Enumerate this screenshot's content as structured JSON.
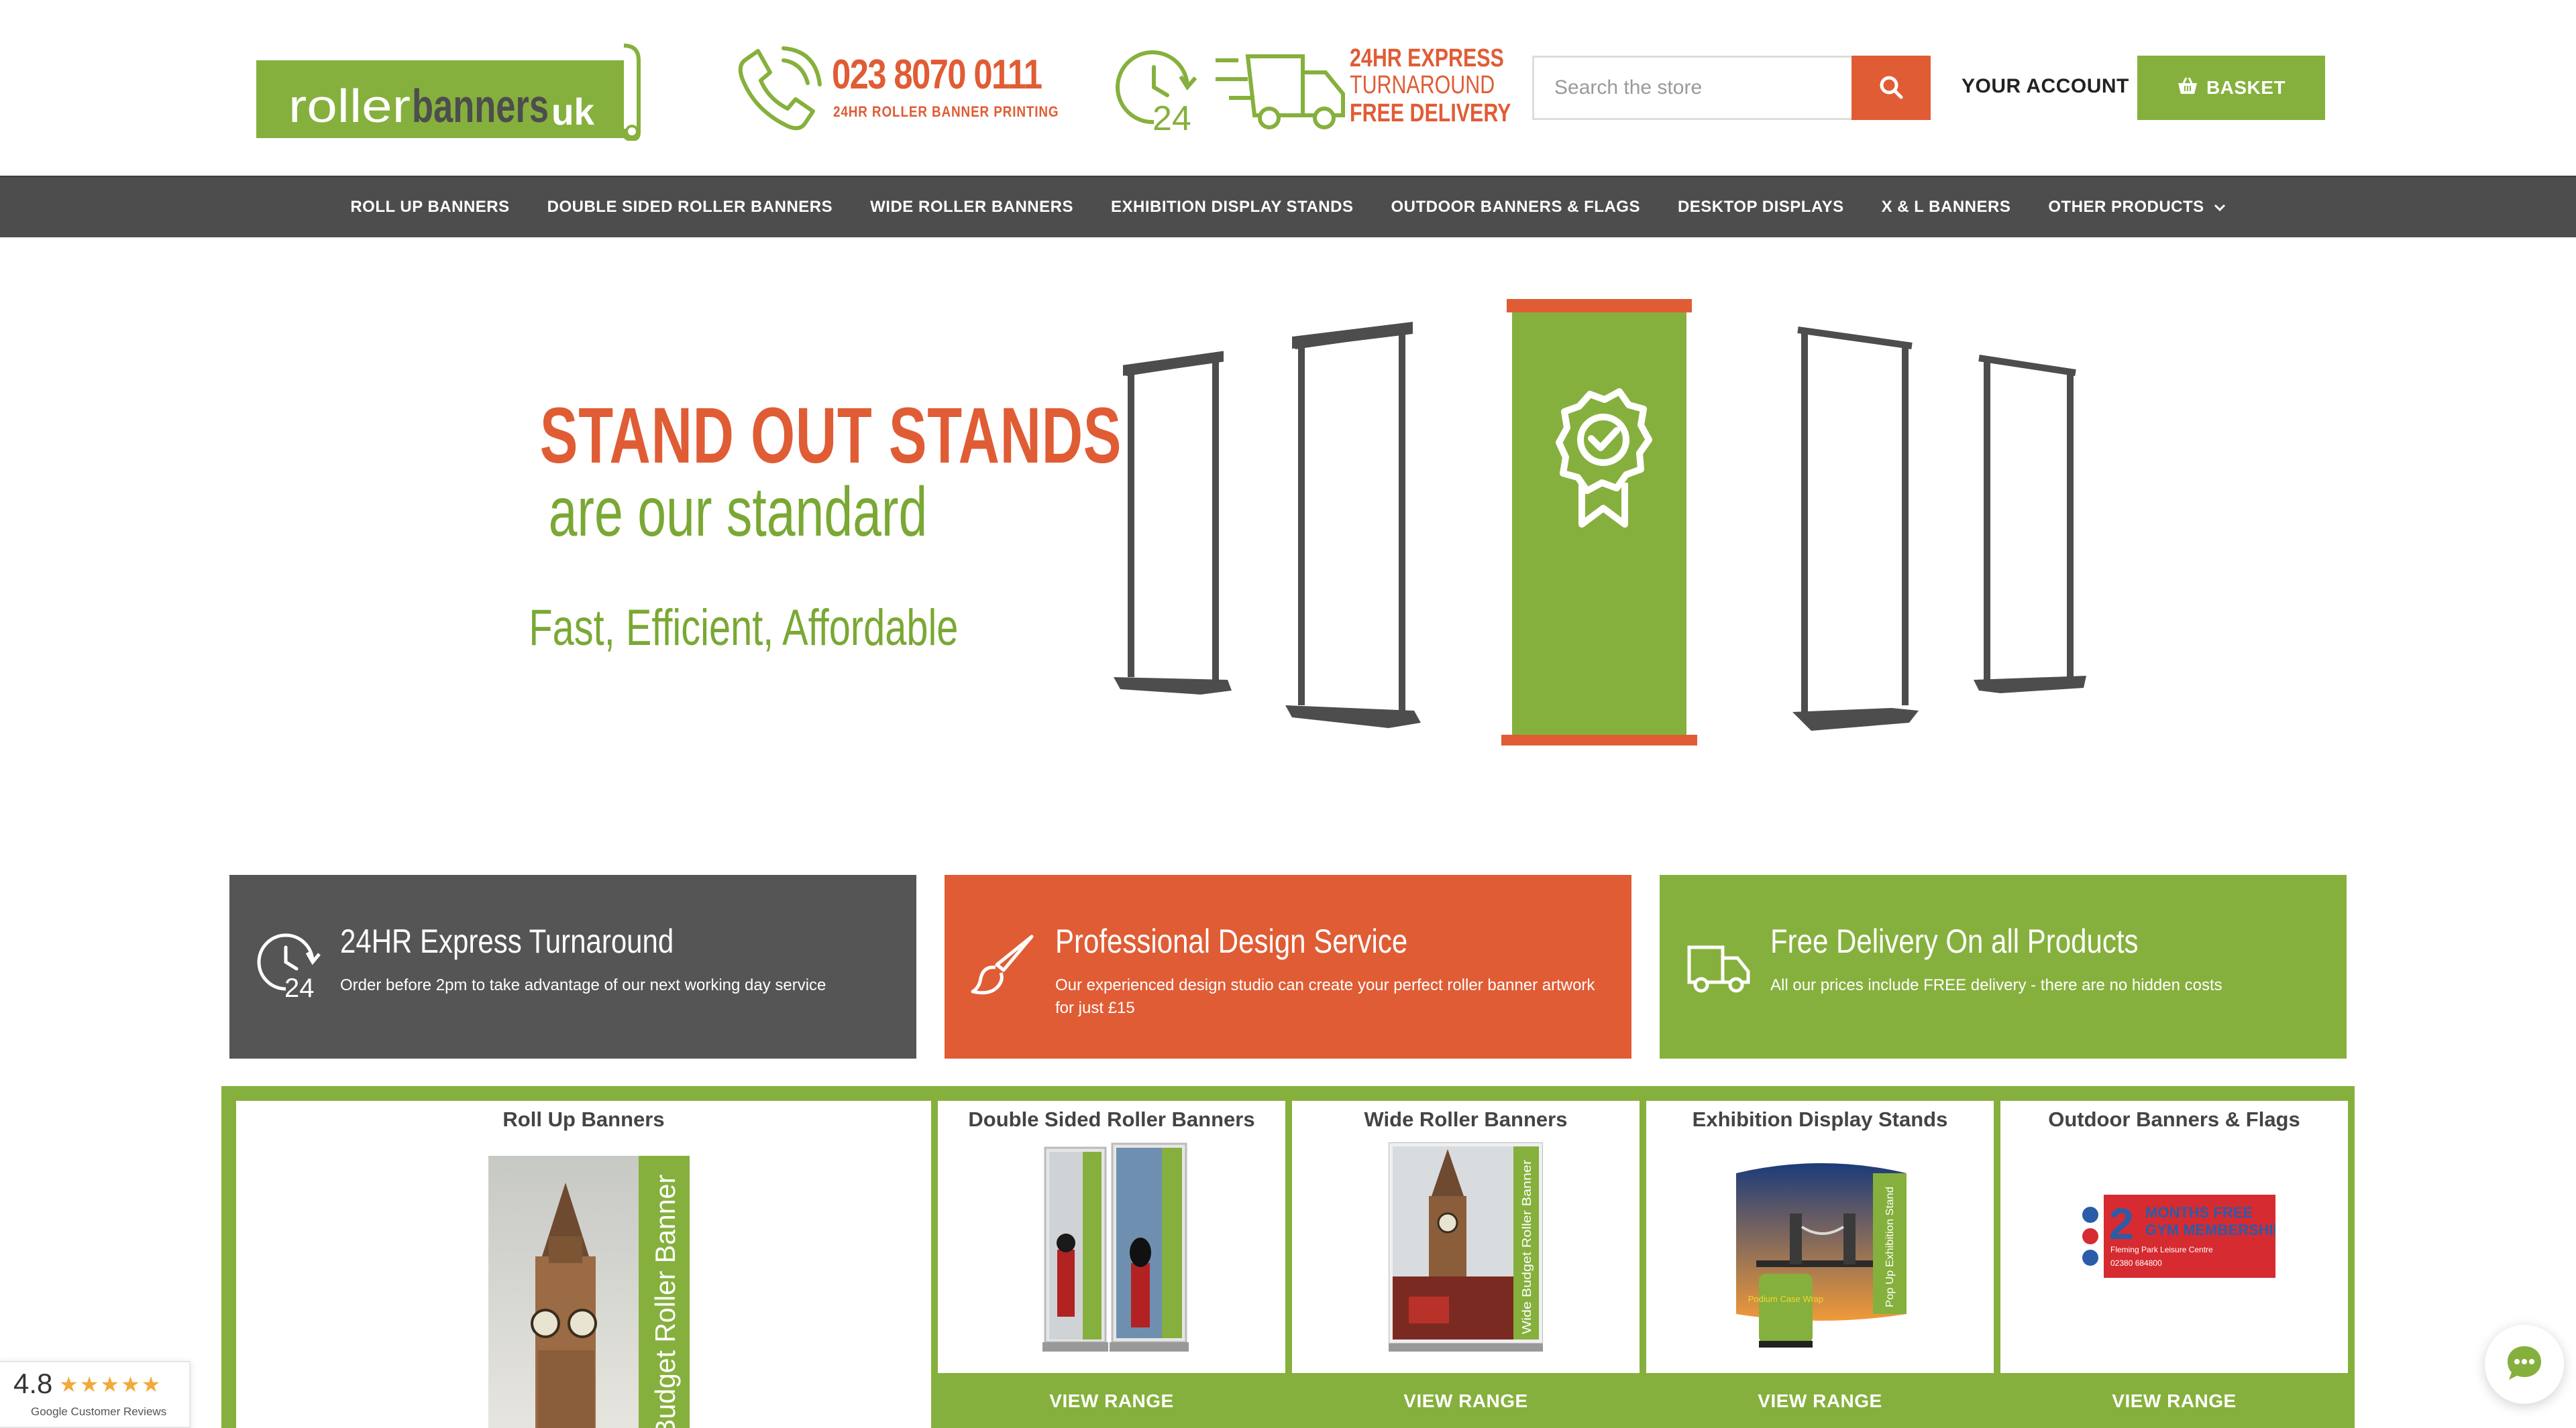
{
  "header": {
    "logo": {
      "word1": "roller",
      "word2": "banners",
      "word3": "uk"
    },
    "phone": {
      "number": "023 8070 0111",
      "sub": "24HR ROLLER BANNER PRINTING"
    },
    "delivery": {
      "line1": "24HR EXPRESS",
      "line2": "TURNAROUND",
      "line3": "FREE DELIVERY",
      "clock_number": "24"
    },
    "search": {
      "placeholder": "Search the store",
      "value": ""
    },
    "account_label": "YOUR ACCOUNT",
    "basket_label": "BASKET"
  },
  "nav": {
    "items": [
      {
        "label": "ROLL UP BANNERS"
      },
      {
        "label": "DOUBLE SIDED ROLLER BANNERS"
      },
      {
        "label": "WIDE ROLLER BANNERS"
      },
      {
        "label": "EXHIBITION DISPLAY STANDS"
      },
      {
        "label": "OUTDOOR BANNERS & FLAGS"
      },
      {
        "label": "DESKTOP DISPLAYS"
      },
      {
        "label": "X & L BANNERS"
      },
      {
        "label": "OTHER PRODUCTS"
      }
    ]
  },
  "hero": {
    "title": "STAND OUT STANDS",
    "subtitle": "are our standard",
    "tagline": "Fast, Efficient, Affordable"
  },
  "features": [
    {
      "title": "24HR Express Turnaround",
      "description": "Order before 2pm to take advantage of our next working day service",
      "icon_number": "24"
    },
    {
      "title": "Professional Design Service",
      "description": "Our experienced design studio can create your perfect roller banner artwork for just £15"
    },
    {
      "title": "Free Delivery On all Products",
      "description": "All our prices include FREE delivery - there are no hidden costs"
    }
  ],
  "categories": [
    {
      "title": "Roll Up Banners",
      "image_text": "Budget Roller Banner"
    },
    {
      "title": "Double Sided Roller Banners",
      "button": "VIEW RANGE"
    },
    {
      "title": "Wide Roller Banners",
      "button": "VIEW RANGE",
      "image_text": "Wide Budget Roller Banner"
    },
    {
      "title": "Exhibition Display Stands",
      "button": "VIEW RANGE",
      "image_text": "Pop Up Exhibition Stand",
      "counter_text": "Podium Case Wrap"
    },
    {
      "title": "Outdoor Banners & Flags",
      "button": "VIEW RANGE",
      "image_line1": "2",
      "image_line2": "MONTHS FREE",
      "image_line3": "GYM MEMBERSHIP",
      "image_line4": "Fleming Park Leisure Centre",
      "image_line5": "02380 684800"
    }
  ],
  "reviews": {
    "score": "4.8",
    "stars": "★★★★★",
    "label": "Google Customer Reviews"
  },
  "colors": {
    "green": "#86b03d",
    "orange": "#e05c35",
    "dark_grey": "#4d4d4d",
    "feature_grey": "#555555"
  },
  "icons": [
    "search-icon",
    "basket-icon",
    "phone-icon",
    "clock-24-icon",
    "truck-icon",
    "award-rosette-icon",
    "paintbrush-icon",
    "chevron-down-icon",
    "chat-icon"
  ]
}
